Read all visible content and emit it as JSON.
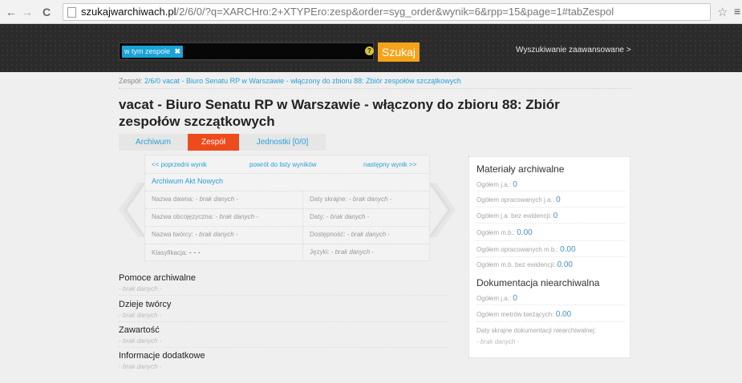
{
  "browser": {
    "url_host": "szukajwarchiwach.pl",
    "url_path": "/2/6/0/?q=XARCHro:2+XTYPEro:zesp&order=syg_order&wynik=6&rpp=15&page=1#tabZespol",
    "back_glyph": "←",
    "forward_glyph": "→",
    "reload_glyph": "C",
    "star_glyph": "☆",
    "menu_glyph": "≡"
  },
  "header": {
    "filter_tag": "w tym zespole",
    "filter_remove": "✖",
    "help_glyph": "?",
    "search_button": "Szukaj",
    "advanced_link": "Wyszukiwanie zaawansowane >"
  },
  "breadcrumb": {
    "label": "Zespół:",
    "text": "2/6/0 vacat - Biuro Senatu RP w Warszawie - włączony do zbioru 88: Zbiór zespołów szczątkowych"
  },
  "title": "vacat - Biuro Senatu RP w Warszawie - włączony do zbioru 88: Zbiór zespołów szczątkowych",
  "tabs": [
    {
      "label": "Archiwum"
    },
    {
      "label": "Zespół"
    },
    {
      "label": "Jednostki [0/0]"
    }
  ],
  "result_nav": {
    "prev": "<< poprzedni wynik",
    "back": "powrót do listy wyników",
    "next": "następny wynik >>"
  },
  "archive_name": "Archiwum Akt Nowych",
  "fields": {
    "nazwa_dawna": {
      "label": "Nazwa dawna:",
      "value": "- brak danych -"
    },
    "daty_skrajne": {
      "label": "Daty skrajne:",
      "value": "- brak danych -"
    },
    "nazwa_obcojezyczna": {
      "label": "Nazwa obcojęzyczna:",
      "value": "- brak danych -"
    },
    "daty": {
      "label": "Daty:",
      "value": "- brak danych -"
    },
    "nazwa_tworcy": {
      "label": "Nazwa twórcy:",
      "value": "- brak danych -"
    },
    "dostepnosc": {
      "label": "Dostępność:",
      "value": "- brak danych -"
    },
    "klasyfikacja": {
      "label": "Klasyfikacja:",
      "value": "- - -"
    },
    "jezyki": {
      "label": "Języki:",
      "value": "- brak danych -"
    }
  },
  "materials": {
    "heading": "Materiały archiwalne",
    "ogolem_ja": {
      "label": "Ogółem j.a.:",
      "value": "0"
    },
    "ogolem_opracowanych_ja": {
      "label": "Ogółem opracowanych j.a.:",
      "value": "0"
    },
    "ogolem_ja_bez_ewidencji": {
      "label": "Ogółem j.a. bez ewidencji:",
      "value": "0"
    },
    "ogolem_mb": {
      "label": "Ogółem m.b.:",
      "value": "0.00"
    },
    "ogolem_opracowanych_mb": {
      "label": "Ogółem opracowanych m.b.:",
      "value": "0.00"
    },
    "ogolem_mb_bez_ewidencji": {
      "label": "Ogółem m.b. bez ewidencji:",
      "value": "0.00"
    }
  },
  "nonarchival": {
    "heading": "Dokumentacja niearchiwalna",
    "ogolem_ja": {
      "label": "Ogółem j.a.:",
      "value": "0"
    },
    "ogolem_metrow": {
      "label": "Ogółem metrów bieżących:",
      "value": "0.00"
    },
    "daty_skrajne": {
      "label": "Daty skrajne dokumentacji niearchiwalnej:",
      "value": "- brak danych -"
    }
  },
  "sections": [
    {
      "heading": "Pomoce archiwalne",
      "value": "- brak danych -"
    },
    {
      "heading": "Dzieje twórcy",
      "value": "- brak danych -"
    },
    {
      "heading": "Zawartość",
      "value": "- brak danych -"
    },
    {
      "heading": "Informacje dodatkowe",
      "value": "- brak danych -"
    }
  ],
  "colors": {
    "accent_blue": "#2aa0d6",
    "tab_active": "#ee4b1d",
    "search_button": "#f5a31a"
  }
}
